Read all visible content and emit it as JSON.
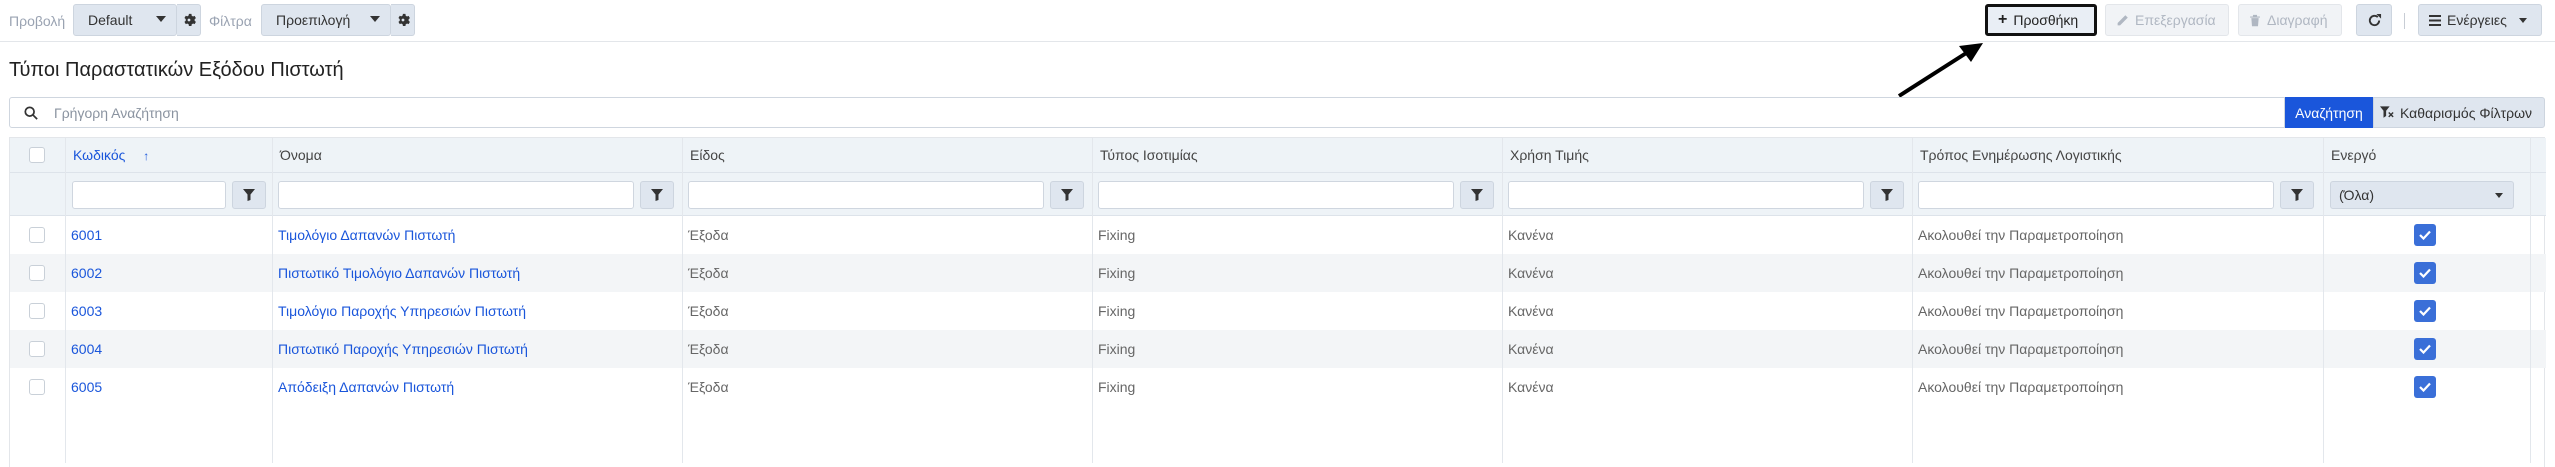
{
  "toolbar": {
    "view_label": "Προβολή",
    "view_value": "Default",
    "filter_label": "Φίλτρα",
    "filter_value": "Προεπιλογή",
    "add_label": "Προσθήκη",
    "edit_label": "Επεξεργασία",
    "delete_label": "Διαγραφή",
    "actions_label": "Ενέργειες"
  },
  "page_title": "Τύποι Παραστατικών Εξόδου Πιστωτή",
  "search": {
    "placeholder": "Γρήγορη Αναζήτηση",
    "search_button": "Αναζήτηση",
    "clear_button": "Καθαρισμός Φίλτρων"
  },
  "table": {
    "columns": [
      "Κωδικός",
      "Όνομα",
      "Είδος",
      "Τύπος Ισοτιμίας",
      "Χρήση Τιμής",
      "Τρόπος Ενημέρωσης Λογιστικής",
      "Ενεργό"
    ],
    "active_filter_value": "(Όλα)",
    "rows": [
      {
        "code": "6001",
        "name": "Τιμολόγιο Δαπανών Πιστωτή",
        "kind": "Έξοδα",
        "rate_type": "Fixing",
        "price_use": "Κανένα",
        "accounting": "Ακολουθεί την Παραμετροποίηση"
      },
      {
        "code": "6002",
        "name": "Πιστωτικό Τιμολόγιο Δαπανών Πιστωτή",
        "kind": "Έξοδα",
        "rate_type": "Fixing",
        "price_use": "Κανένα",
        "accounting": "Ακολουθεί την Παραμετροποίηση"
      },
      {
        "code": "6003",
        "name": "Τιμολόγιο Παροχής Υπηρεσιών Πιστωτή",
        "kind": "Έξοδα",
        "rate_type": "Fixing",
        "price_use": "Κανένα",
        "accounting": "Ακολουθεί την Παραμετροποίηση"
      },
      {
        "code": "6004",
        "name": "Πιστωτικό Παροχής Υπηρεσιών Πιστωτή",
        "kind": "Έξοδα",
        "rate_type": "Fixing",
        "price_use": "Κανένα",
        "accounting": "Ακολουθεί την Παραμετροποίηση"
      },
      {
        "code": "6005",
        "name": "Απόδειξη Δαπανών Πιστωτή",
        "kind": "Έξοδα",
        "rate_type": "Fixing",
        "price_use": "Κανένα",
        "accounting": "Ακολουθεί την Παραμετροποίηση"
      }
    ]
  }
}
